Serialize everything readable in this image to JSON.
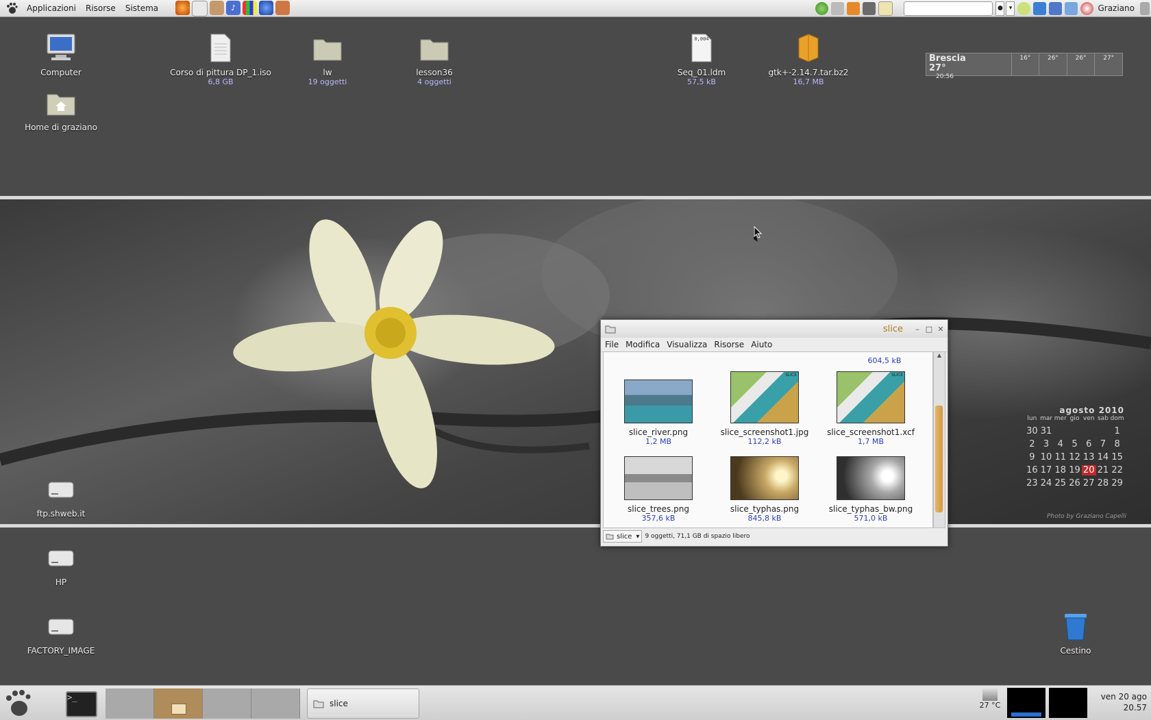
{
  "top_panel": {
    "menus": [
      "Applicazioni",
      "Risorse",
      "Sistema"
    ],
    "user": "Graziano"
  },
  "desktop": {
    "icons": [
      {
        "label": "Computer",
        "sub": ""
      },
      {
        "label": "Home di graziano",
        "sub": ""
      },
      {
        "label": "Corso di pittura DP_1.iso",
        "sub": "6,8 GB"
      },
      {
        "label": "lw",
        "sub": "19 oggetti"
      },
      {
        "label": "lesson36",
        "sub": "4 oggetti"
      },
      {
        "label": "Seq_01.ldm",
        "sub": "57,5 kB"
      },
      {
        "label": "gtk+-2.14.7.tar.bz2",
        "sub": "16,7 MB"
      },
      {
        "label": "ftp.shweb.it",
        "sub": ""
      },
      {
        "label": "HP",
        "sub": ""
      },
      {
        "label": "FACTORY_IMAGE",
        "sub": ""
      },
      {
        "label": "Cestino",
        "sub": ""
      }
    ],
    "seq_icon_text": "0,004"
  },
  "weather": {
    "city": "Brescia",
    "temp": "27°",
    "time": "20:56",
    "days": [
      "16°",
      "26°",
      "26°",
      "27°"
    ]
  },
  "calendar": {
    "title": "agosto 2010",
    "weekdays": [
      "lun",
      "mar",
      "mer",
      "gio",
      "ven",
      "sab",
      "dom"
    ],
    "weeks": [
      [
        "30",
        "31",
        "",
        "",
        "",
        "",
        "1"
      ],
      [
        "2",
        "3",
        "4",
        "5",
        "6",
        "7",
        "8"
      ],
      [
        "9",
        "10",
        "11",
        "12",
        "13",
        "14",
        "15"
      ],
      [
        "16",
        "17",
        "18",
        "19",
        "20",
        "21",
        "22"
      ],
      [
        "23",
        "24",
        "25",
        "26",
        "27",
        "28",
        "29"
      ]
    ],
    "today": "20"
  },
  "wallpaper": {
    "credit": "Photo by Graziano Capelli"
  },
  "file_manager": {
    "title": "slice",
    "menus": [
      "File",
      "Modifica",
      "Visualizza",
      "Risorse",
      "Aiuto"
    ],
    "top_partial_size": "604,5 kB",
    "files": [
      {
        "name": "slice_river.png",
        "size": "1,2 MB"
      },
      {
        "name": "slice_screenshot1.jpg",
        "size": "112,2 kB"
      },
      {
        "name": "slice_screenshot1.xcf",
        "size": "1,7 MB"
      },
      {
        "name": "slice_trees.png",
        "size": "357,6 kB"
      },
      {
        "name": "slice_typhas.png",
        "size": "845,8 kB"
      },
      {
        "name": "slice_typhas_bw.png",
        "size": "571,0 kB"
      }
    ],
    "thumb_badge": "SLICE",
    "location": "slice",
    "status": "9 oggetti, 71,1 GB di spazio libero"
  },
  "bottom_panel": {
    "task_label": "slice",
    "temperature": "27 °C",
    "date": "ven 20 ago",
    "time": "20.57"
  }
}
